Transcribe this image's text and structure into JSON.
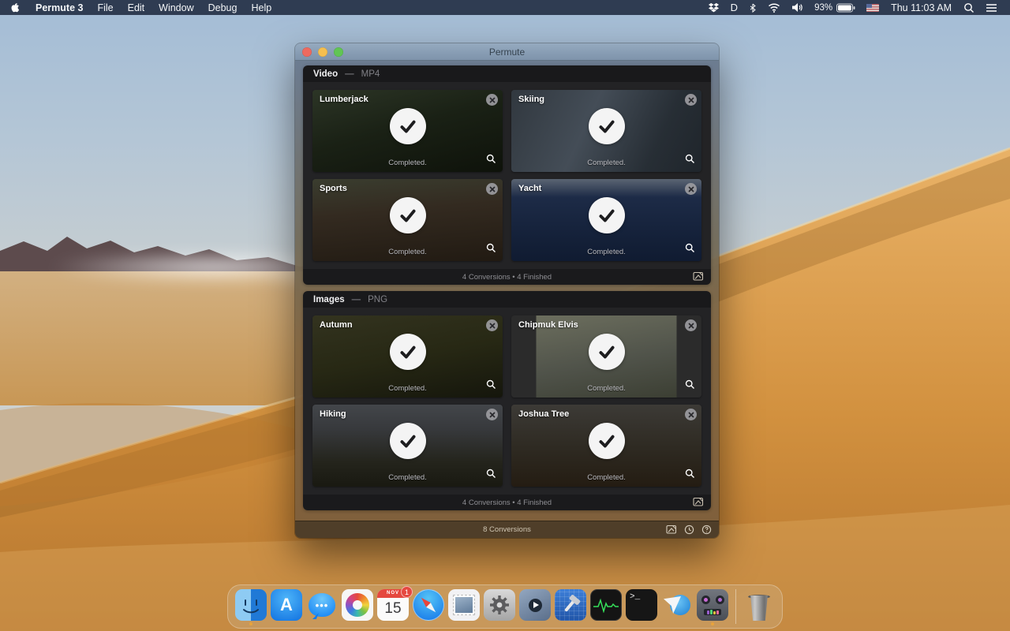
{
  "menu_bar": {
    "app_name": "Permute 3",
    "menus": [
      "File",
      "Edit",
      "Window",
      "Debug",
      "Help"
    ],
    "battery_percent": "93%",
    "clock": "Thu 11:03 AM",
    "status_icon_names": [
      "dropbox-icon",
      "d-app-icon",
      "bluetooth-icon",
      "wifi-icon",
      "volume-icon",
      "battery-icon",
      "input-flag-icon",
      "spotlight-icon",
      "notification-center-icon"
    ]
  },
  "window": {
    "title": "Permute",
    "groups": [
      {
        "name": "Video",
        "dash": "—",
        "format": "MP4",
        "footer": "4 Conversions • 4 Finished",
        "items": [
          {
            "title": "Lumberjack",
            "status": "Completed.",
            "thumb": "background:linear-gradient(165deg,#2c3526 0%,#1a2115 45%,#0e120a 100%)"
          },
          {
            "title": "Skiing",
            "status": "Completed.",
            "thumb": "background:linear-gradient(115deg,#31383f 0%,#444d57 40%,#272e35 75%,#1f252b 100%)"
          },
          {
            "title": "Sports",
            "status": "Completed.",
            "thumb": "background:linear-gradient(175deg,#3a3d2f 0%,#332a20 40%,#211a12 100%)"
          },
          {
            "title": "Yacht",
            "status": "Completed.",
            "thumb": "background:linear-gradient(180deg,#5a6472 0%,#1d2b47 22%,#16233c 60%,#101b31 100%)"
          }
        ]
      },
      {
        "name": "Images",
        "dash": "—",
        "format": "PNG",
        "footer": "4 Conversions • 4 Finished",
        "items": [
          {
            "title": "Autumn",
            "status": "Completed.",
            "thumb": "background:linear-gradient(170deg,#33331f 0%,#272814 50%,#15160c 100%)"
          },
          {
            "title": "Chipmuk Elvis",
            "status": "Completed.",
            "thumb": "background:linear-gradient(90deg,#2b2b2b 0%,#2b2b2b 13%,rgba(0,0,0,0) 13%,rgba(0,0,0,0) 87%,#2b2b2b 87%),linear-gradient(170deg,#6e705f 0%,#50534a 55%,#3a3d31 100%)"
          },
          {
            "title": "Hiking",
            "status": "Completed.",
            "thumb": "background:linear-gradient(180deg,#43464a 0%,#37393c 30%,#24241c 70%,#191911 100%)"
          },
          {
            "title": "Joshua Tree",
            "status": "Completed.",
            "thumb": "background:linear-gradient(180deg,#3c3a36 0%,#2f2b23 50%,#241c12 100%)"
          }
        ]
      }
    ],
    "status_text": "8 Conversions"
  },
  "dock": {
    "calendar": {
      "month": "NOV",
      "day": "15",
      "badge": "1"
    },
    "appstore_letter": "A",
    "messages_dots": "•••",
    "terminal_prompt": ">_",
    "app_names": [
      "finder",
      "app-store",
      "messages",
      "photos",
      "calendar",
      "safari",
      "mail",
      "system-preferences",
      "quicktime-player",
      "xcode",
      "activity-monitor",
      "terminal",
      "downie",
      "permute",
      "trash"
    ]
  }
}
